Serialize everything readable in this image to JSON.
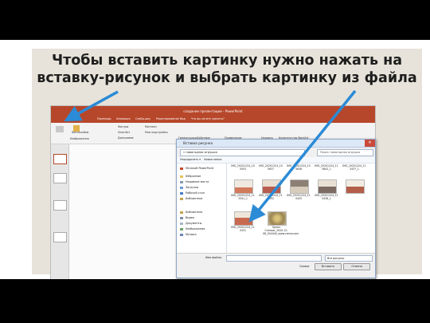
{
  "title_line1": "Чтобы вставить картинку нужно нажать на",
  "title_line2": "вставку-рисунок и выбрать картинку из файла",
  "ppt": {
    "window_title": "создание презентации - PowerPoint",
    "tabs": [
      "Переходы",
      "Анимация",
      "Слайд-шоу",
      "Рецензирование",
      "Вид",
      "Что вы хотите сделать?"
    ],
    "ribbon": {
      "shapes": "Фигуры",
      "smartart": "SmartArt",
      "chart": "Диаграмма",
      "store": "Магазин",
      "my_addins": "Мои надстройки",
      "hyperlink": "Гиперссылка",
      "action": "Действие",
      "comment": "Примечание",
      "textbox": "Надпись",
      "headers": "Колонтитулы",
      "wordart": "WordArt",
      "photo_album": "Фотоальбом",
      "images_group": "Изображения"
    }
  },
  "dialog": {
    "title": "Вставка рисунка",
    "close": "✕",
    "address": "« новогодняя игрушка",
    "search_placeholder": "Поиск: новогодняя игрушка",
    "organize": "Упорядочить ▾",
    "new_folder": "Новая папка",
    "nav": [
      "Microsoft PowerPoint",
      "Избранное",
      "Недавние места",
      "Загрузки",
      "Рабочий стол",
      "Библиотеки",
      "Библиотеки",
      "Видео",
      "Документы",
      "Изображения",
      "Музыка"
    ],
    "files": [
      "IMG_20201224_10 5553",
      "IMG_20201224_10 5637",
      "IMG_20201224_10 5638",
      "IMG_20201224_11 3642_1",
      "IMG_20201224_11 3437_1",
      "IMG_20201224_11 3341_1",
      "IMG_20201224_11 3352",
      "IMG_20201224_11 5425",
      "IMG_20201224_11 5438_1",
      "IMG_20201224_11 5431",
      "Орнел Снежок_2020-12-08_004440_www.canva.com"
    ],
    "filename_label": "Имя файла:",
    "filetype": "Все рисунки",
    "service": "Сервис",
    "insert": "Вставить",
    "cancel": "Отмена"
  },
  "colors": {
    "ppt_accent": "#b7472a",
    "arrow": "#2b8bd6",
    "band": "#e7e3da"
  }
}
